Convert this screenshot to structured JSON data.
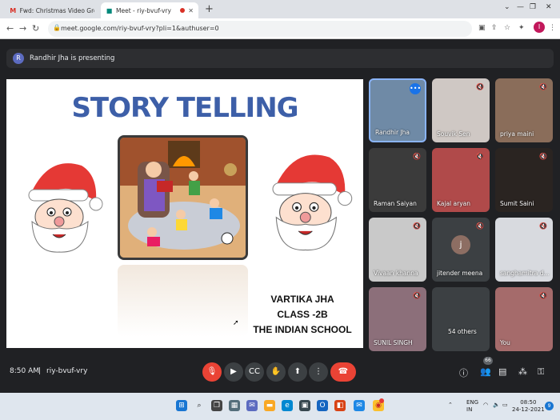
{
  "browser": {
    "tabs": [
      {
        "label": "Fwd: Christmas Video Group A a",
        "icon": "gmail-icon"
      },
      {
        "label": "Meet - riy-bvuf-vry",
        "icon": "meet-icon"
      }
    ],
    "url": "meet.google.com/riy-bvuf-vry?pli=1&authuser=0",
    "profile_initial": "I"
  },
  "presenting": {
    "initial": "R",
    "text": "Randhir Jha is presenting"
  },
  "slide": {
    "title": "STORY TELLING",
    "caption_lines": [
      "VARTIKA JHA",
      "CLASS -2B",
      "THE INDIAN SCHOOL"
    ]
  },
  "participants": [
    {
      "name": "Randhir Jha",
      "state": "more"
    },
    {
      "name": "Souvik Sen",
      "state": "muted"
    },
    {
      "name": "priya maini",
      "state": "muted"
    },
    {
      "name": "Raman Saiyan",
      "state": "muted"
    },
    {
      "name": "Kajal aryan",
      "state": "muted"
    },
    {
      "name": "Sumit Saini",
      "state": "muted"
    },
    {
      "name": "Vivaan khanna",
      "state": "muted"
    },
    {
      "name": "jitender meena",
      "state": "muted",
      "initial": "j"
    },
    {
      "name": "sanghamitra d...",
      "state": "muted"
    },
    {
      "name": "SUNIL SINGH",
      "state": "muted"
    },
    {
      "name": "54 others",
      "state": "none"
    },
    {
      "name": "You",
      "state": "muted"
    }
  ],
  "meeting": {
    "time": "8:50 AM",
    "code": "riy-bvuf-vry",
    "people_count": "66"
  },
  "taskbar": {
    "lang": "ENG",
    "region": "IN",
    "time": "08:50",
    "date": "24-12-2021",
    "notif_count": "9"
  },
  "colors": {
    "meet_dark": "#202124",
    "tile_bg": "#3c4043",
    "end_call": "#ea4335",
    "title_blue": "#3d5fa8"
  }
}
